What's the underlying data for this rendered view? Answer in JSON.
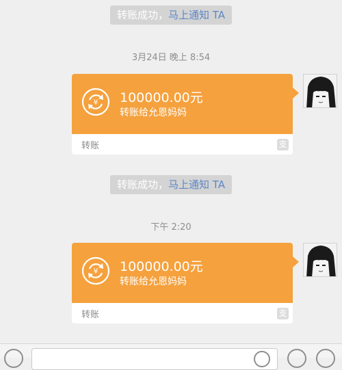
{
  "messages": [
    {
      "notice": {
        "status": "转账成功，",
        "link": "马上通知 TA"
      },
      "time": "3月24日 晚上 8:54",
      "transfer": {
        "amount": "100000.00元",
        "note": "转账给允恩妈妈",
        "type_label": "转账",
        "payment_icon": "alipay-icon",
        "payment_icon_glyph": "支"
      }
    },
    {
      "notice": {
        "status": "转账成功，",
        "link": "马上通知 TA"
      },
      "time": "下午 2:20",
      "transfer": {
        "amount": "100000.00元",
        "note": "转账给允恩妈妈",
        "type_label": "转账",
        "payment_icon": "alipay-icon",
        "payment_icon_glyph": "支"
      }
    }
  ],
  "colors": {
    "background": "#efefef",
    "transfer_card": "#f5a13d",
    "notice_bg": "#d4d4d4",
    "link": "#5d86c5",
    "timestamp": "#8e8e8e"
  },
  "input_bar": {
    "left_icon": "voice-icon",
    "right_icons": [
      "emoji-icon",
      "plus-icon"
    ]
  }
}
